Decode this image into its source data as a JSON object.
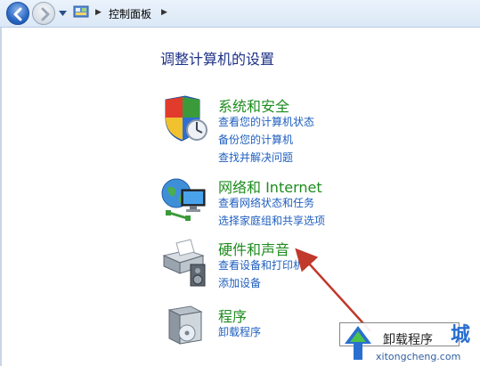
{
  "breadcrumb": {
    "location": "控制面板"
  },
  "page": {
    "title": "调整计算机的设置"
  },
  "categories": [
    {
      "heading": "系统和安全",
      "links": [
        "查看您的计算机状态",
        "备份您的计算机",
        "查找并解决问题"
      ]
    },
    {
      "heading": "网络和 Internet",
      "links": [
        "查看网络状态和任务",
        "选择家庭组和共享选项"
      ]
    },
    {
      "heading": "硬件和声音",
      "links": [
        "查看设备和打印机",
        "添加设备"
      ]
    },
    {
      "heading": "程序",
      "links": [
        "卸载程序"
      ]
    }
  ],
  "watermark": {
    "box_text": "卸载程序",
    "url": "xitongcheng.com",
    "brand": "城"
  },
  "annotation": {
    "arrow_color": "#c0392b"
  }
}
